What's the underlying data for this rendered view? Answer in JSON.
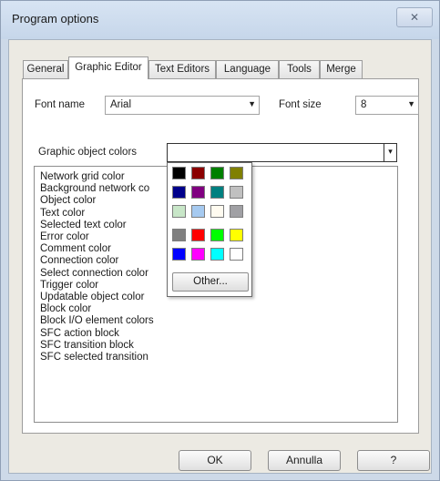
{
  "window": {
    "title": "Program options",
    "close_glyph": "✕"
  },
  "tabs": [
    {
      "label": "General"
    },
    {
      "label": "Graphic Editor"
    },
    {
      "label": "Text Editors"
    },
    {
      "label": "Language"
    },
    {
      "label": "Tools"
    },
    {
      "label": "Merge"
    }
  ],
  "font": {
    "name_label": "Font name",
    "name_value": "Arial",
    "size_label": "Font size",
    "size_value": "8"
  },
  "colors": {
    "label": "Graphic object colors",
    "dropdown_glyph": "▾",
    "palette": [
      "#000000",
      "#8b0000",
      "#008000",
      "#808000",
      "#00008b",
      "#800080",
      "#008080",
      "#c0c0c0",
      "#c8e6c8",
      "#a6caf0",
      "#fffbf0",
      "#a0a0a4",
      "#808080",
      "#ff0000",
      "#00ff00",
      "#ffff00",
      "#0000ff",
      "#ff00ff",
      "#00ffff",
      "#ffffff"
    ],
    "other_label": "Other..."
  },
  "color_items": [
    "Network grid color",
    "Background network co",
    "Object color",
    "Text color",
    "Selected text color",
    "Error color",
    "Comment color",
    "Connection color",
    "Select connection color",
    "Trigger color",
    "Updatable object color",
    "Block color",
    "Block I/O element colors",
    "SFC action block",
    "SFC transition block",
    "SFC selected transition"
  ],
  "buttons": {
    "ok": "OK",
    "cancel": "Annulla",
    "help": "?"
  },
  "dropdown_arrow": "▼"
}
